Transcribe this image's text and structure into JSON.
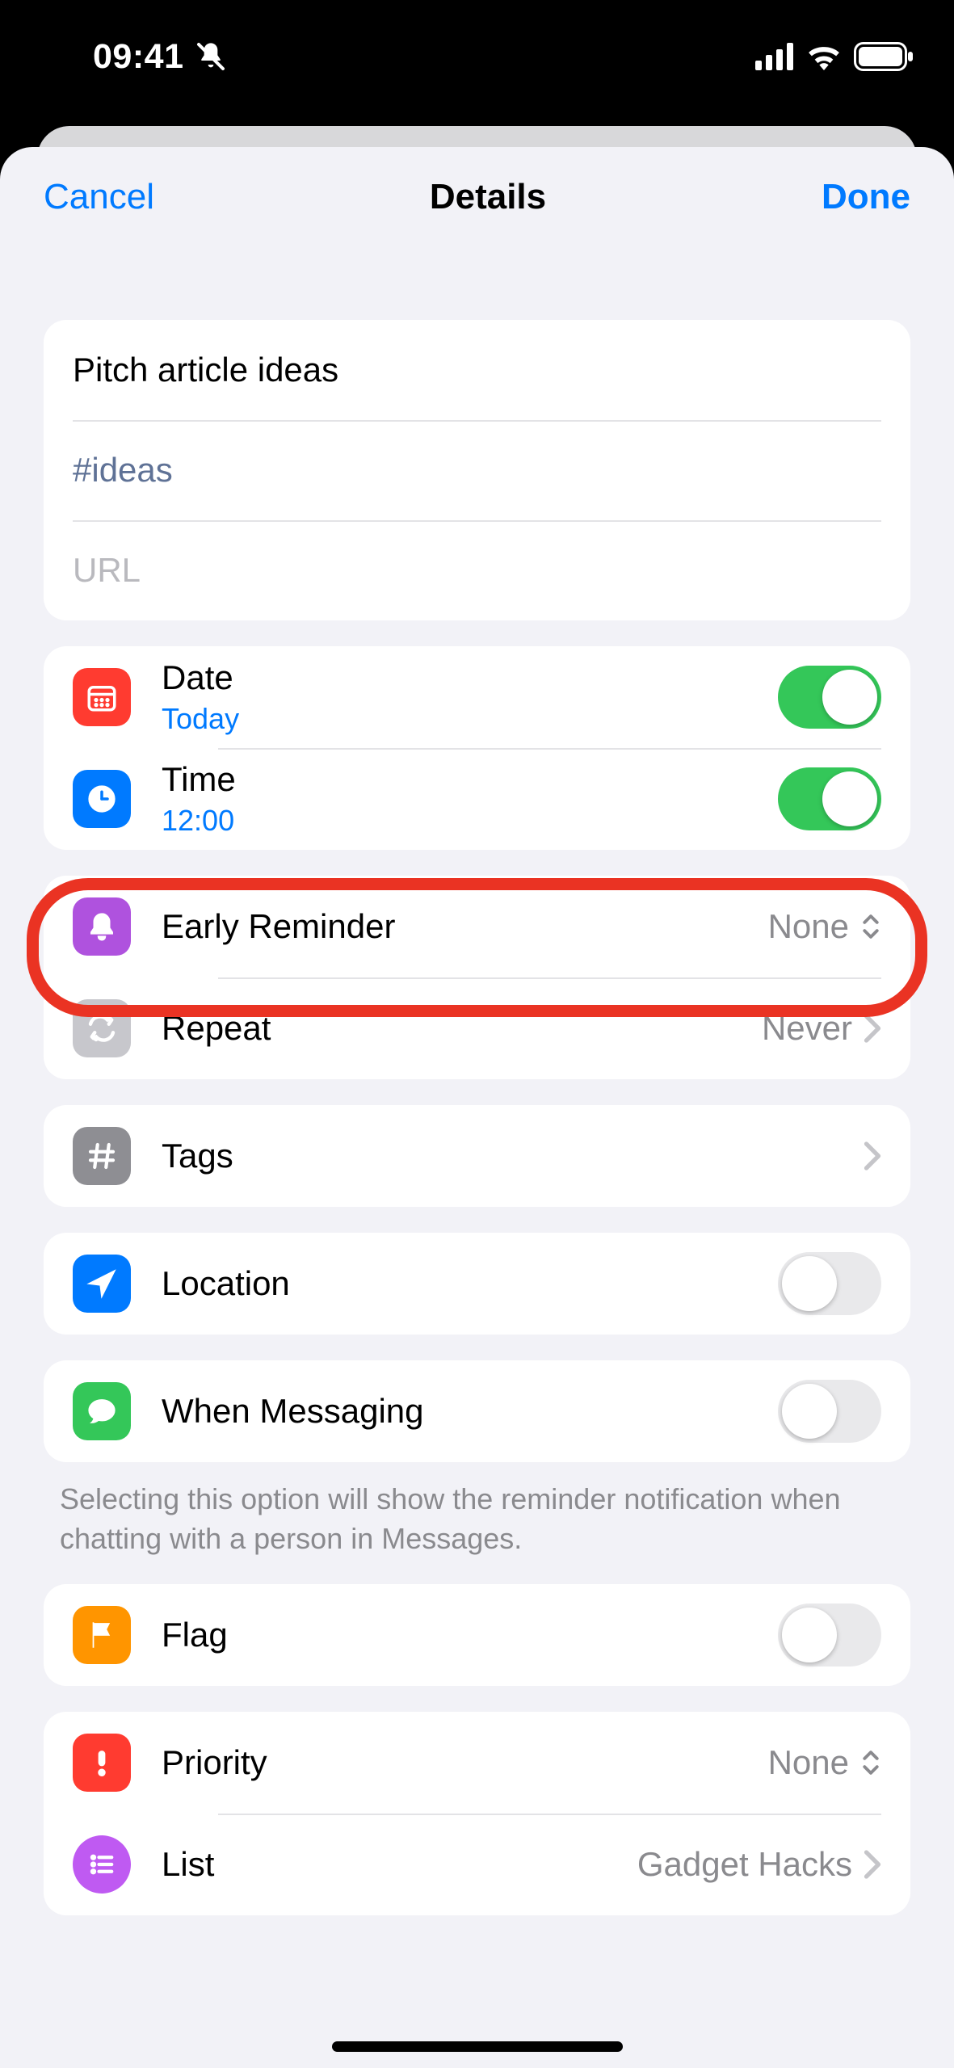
{
  "status": {
    "time": "09:41"
  },
  "nav": {
    "cancel": "Cancel",
    "title": "Details",
    "done": "Done"
  },
  "reminder": {
    "title": "Pitch article ideas",
    "notes": "#ideas",
    "url_placeholder": "URL"
  },
  "date": {
    "label": "Date",
    "value": "Today"
  },
  "time": {
    "label": "Time",
    "value": "12:00"
  },
  "early_reminder": {
    "label": "Early Reminder",
    "value": "None"
  },
  "repeat": {
    "label": "Repeat",
    "value": "Never"
  },
  "tags": {
    "label": "Tags"
  },
  "location": {
    "label": "Location"
  },
  "messaging": {
    "label": "When Messaging",
    "footnote": "Selecting this option will show the reminder notification when chatting with a person in Messages."
  },
  "flag": {
    "label": "Flag"
  },
  "priority": {
    "label": "Priority",
    "value": "None"
  },
  "list": {
    "label": "List",
    "value": "Gadget Hacks"
  }
}
